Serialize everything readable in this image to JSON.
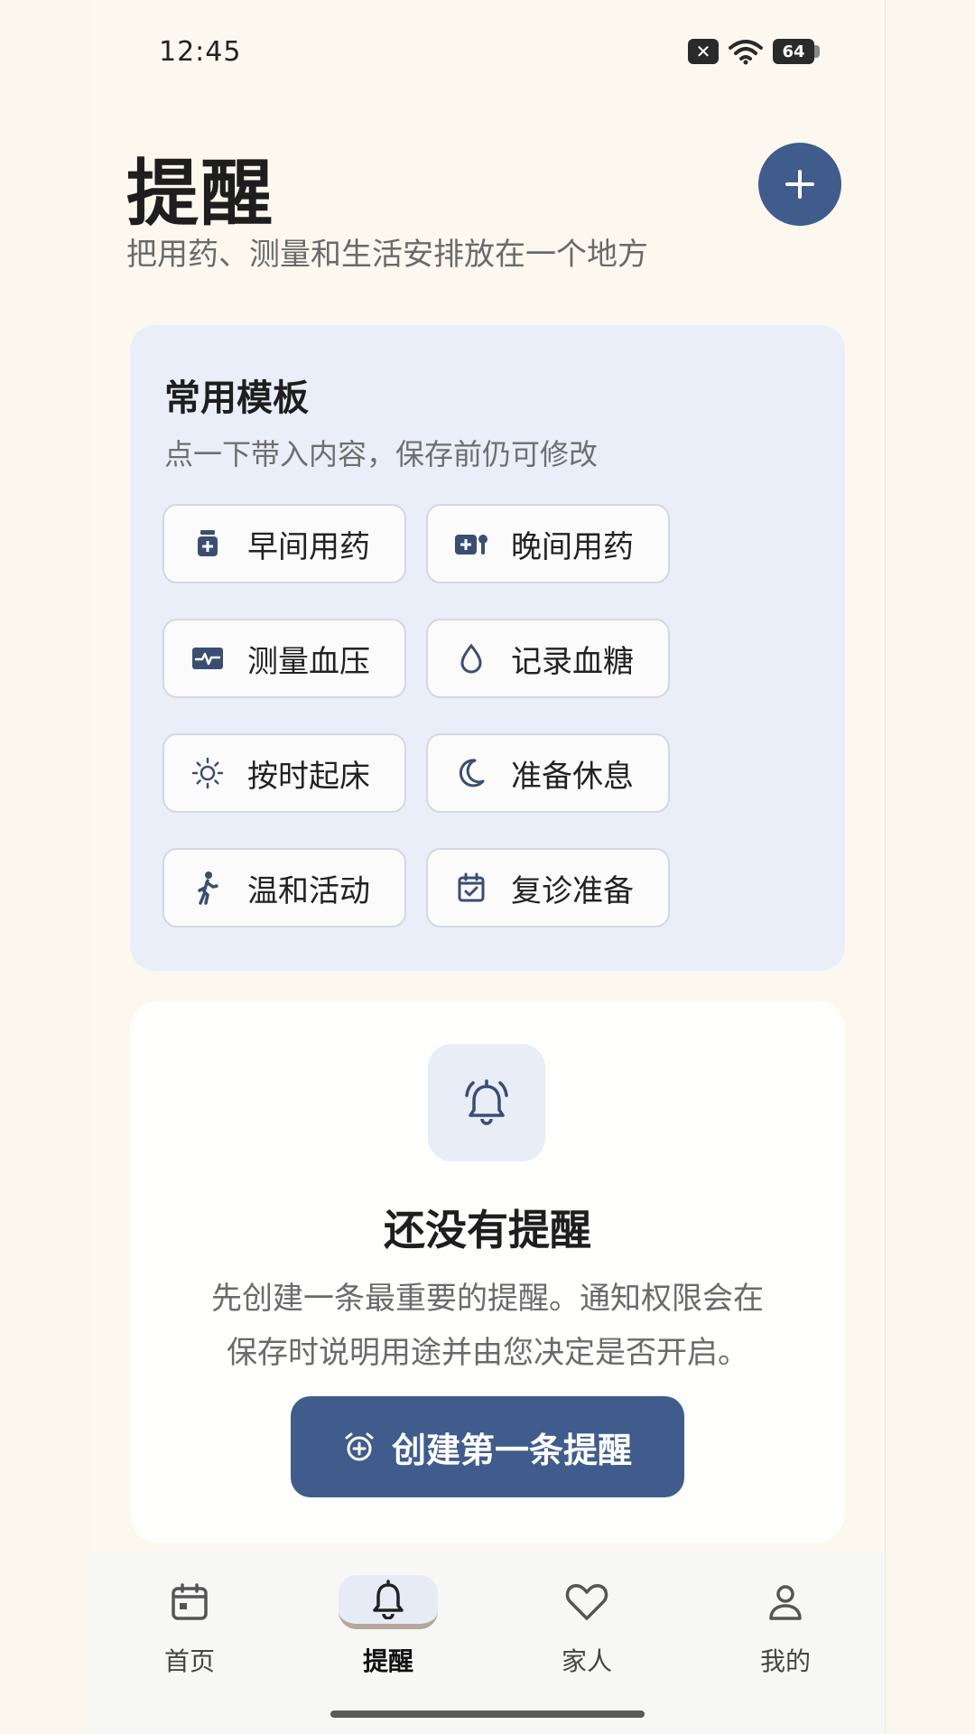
{
  "status_bar": {
    "time": "12:45",
    "battery": "64"
  },
  "header": {
    "title": "提醒",
    "subtitle": "把用药、测量和生活安排放在一个地方"
  },
  "templates": {
    "title": "常用模板",
    "subtitle": "点一下带入内容，保存前仍可修改",
    "items": [
      {
        "label": "早间用药",
        "icon": "pill-bottle-icon"
      },
      {
        "label": "晚间用药",
        "icon": "medicine-kit-icon"
      },
      {
        "label": "测量血压",
        "icon": "heart-pulse-icon"
      },
      {
        "label": "记录血糖",
        "icon": "drop-icon"
      },
      {
        "label": "按时起床",
        "icon": "sun-icon"
      },
      {
        "label": "准备休息",
        "icon": "moon-icon"
      },
      {
        "label": "温和活动",
        "icon": "walking-icon"
      },
      {
        "label": "复诊准备",
        "icon": "calendar-check-icon"
      }
    ]
  },
  "empty_state": {
    "title": "还没有提醒",
    "description_line1": "先创建一条最重要的提醒。通知权限会在",
    "description_line2": "保存时说明用途并由您决定是否开启。",
    "button_label": "创建第一条提醒"
  },
  "bottom_nav": {
    "items": [
      {
        "label": "首页",
        "icon": "calendar-icon"
      },
      {
        "label": "提醒",
        "icon": "bell-icon"
      },
      {
        "label": "家人",
        "icon": "heart-icon"
      },
      {
        "label": "我的",
        "icon": "person-icon"
      }
    ],
    "active": "提醒"
  },
  "colors": {
    "primary": "#405C8C",
    "background": "#FCF8EF",
    "card": "#E9EEF9"
  }
}
